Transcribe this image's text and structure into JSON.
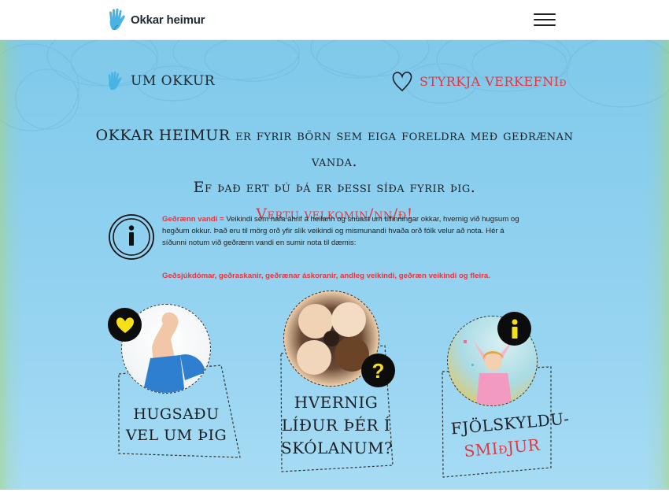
{
  "header": {
    "logo_text": "Okkar heimur",
    "menu_icon": "hamburger-menu-icon"
  },
  "nav": {
    "about_label": "UM OKKUR",
    "support_label": "STYRKJA VERKEFNIð"
  },
  "intro": {
    "line1": "OKKAR HEIMUR er fyrir börn sem eiga foreldra með geðrænan vanda.",
    "line2": "Ef það ert þú þá er þessi síða fyrir þig.",
    "line3": "Vertu velkomin/nn/ð!"
  },
  "info": {
    "term": "Geðrænn vandi =",
    "text": "Veikindi sem hafa áhrif á heilann og snúast um tilfinningar okkar, hvernig við hugsum og hegðum okkur. Það eru til mörg orð yfir slík veikindi og mismunandi hvaða orð fólk velur að nota. Hér á síðunni notum við geðrænn vandi en sumir nota til dæmis:",
    "examples": "Geðsjúkdómar, geðraskanir, geðrænar áskoranir, andleg veikindi, geðræn veikindi og fleira."
  },
  "cards": [
    {
      "title_line1": "HUGSAÐU",
      "title_line2": "VEL UM ÞIG",
      "badge_icon": "heart-icon"
    },
    {
      "title_line1": "HVERNIG",
      "title_line2": "LÍÐUR ÞÉR Í",
      "title_line3": "SKÓLANUM?",
      "badge_icon": "question-icon"
    },
    {
      "title_line1": "FJÖLSKYLDU-",
      "title_line2": "SMIðJUR",
      "badge_icon": "info-icon"
    }
  ],
  "colors": {
    "accent_red": "#e4363f",
    "badge_yellow": "#f5e11a",
    "background_blue": "#8ed0ef",
    "logo_blue": "#49b3e3"
  }
}
